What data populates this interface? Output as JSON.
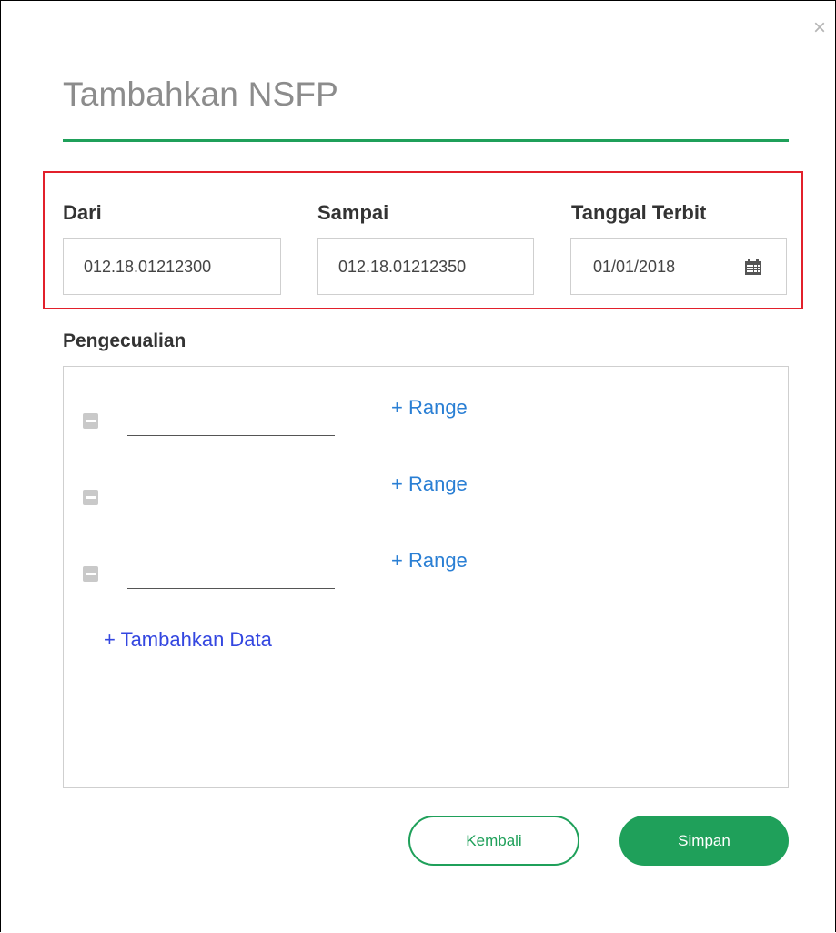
{
  "dialog": {
    "title": "Tambahkan NSFP",
    "close_icon": "×"
  },
  "form": {
    "dari_label": "Dari",
    "dari_value": "012.18.01212300",
    "sampai_label": "Sampai",
    "sampai_value": "012.18.01212350",
    "tanggal_label": "Tanggal Terbit",
    "tanggal_value": "01/01/2018",
    "calendar_icon": "calendar-icon"
  },
  "exclusions": {
    "label": "Pengecualian",
    "rows": [
      {
        "value": "",
        "range_label": "+ Range"
      },
      {
        "value": "",
        "range_label": "+ Range"
      },
      {
        "value": "",
        "range_label": "+ Range"
      }
    ],
    "add_label": "+ Tambahkan Data"
  },
  "actions": {
    "back_label": "Kembali",
    "save_label": "Simpan"
  },
  "colors": {
    "accent": "#1fa05a",
    "highlight": "#e2202b",
    "link": "#2a7fd4",
    "add_link": "#3447e0"
  }
}
